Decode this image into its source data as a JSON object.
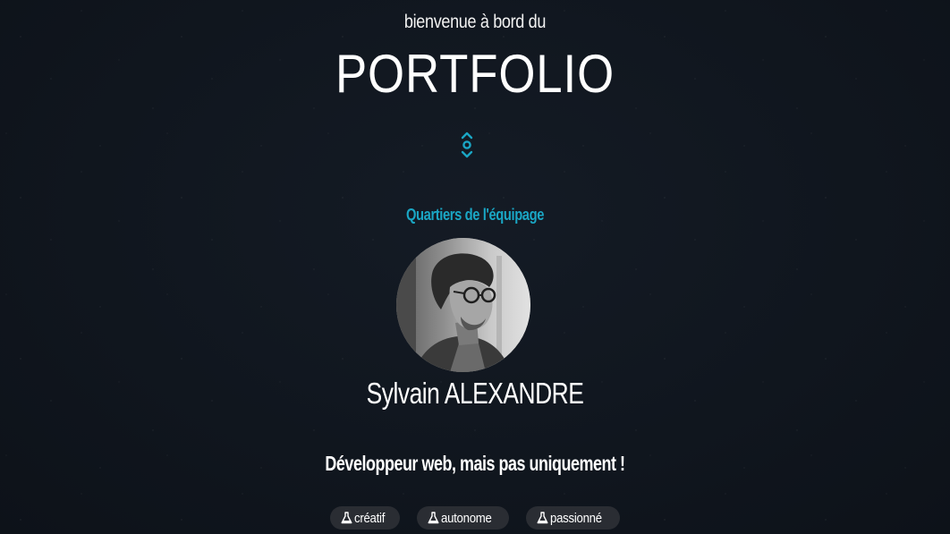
{
  "hero": {
    "welcome": "bienvenue à bord du",
    "title": "PORTFOLIO",
    "scroll_icon": "scroll-arrows-icon"
  },
  "crew": {
    "section_title": "Quartiers de l'équipage",
    "avatar_icon": "profile-photo",
    "name": "Sylvain ALEXANDRE",
    "tagline": "Développeur web, mais pas uniquement !",
    "tags": [
      {
        "label": "créatif",
        "icon": "flask-icon"
      },
      {
        "label": "autonome",
        "icon": "flask-icon"
      },
      {
        "label": "passionné",
        "icon": "flask-icon"
      }
    ]
  },
  "colors": {
    "accent": "#1aa6c4",
    "background": "#10151d",
    "tag_background": "#2a2d33"
  }
}
